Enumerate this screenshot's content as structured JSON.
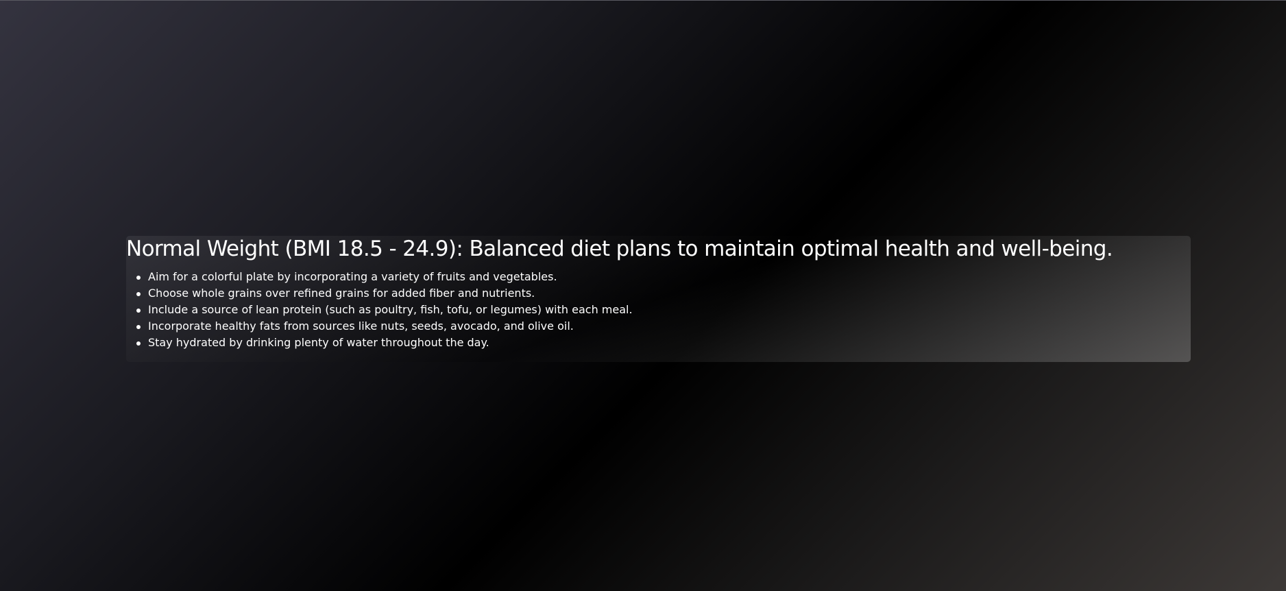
{
  "card": {
    "title": "Normal Weight (BMI 18.5 - 24.9): Balanced diet plans to maintain optimal health and well-being.",
    "tips": [
      "Aim for a colorful plate by incorporating a variety of fruits and vegetables.",
      "Choose whole grains over refined grains for added fiber and nutrients.",
      "Include a source of lean protein (such as poultry, fish, tofu, or legumes) with each meal.",
      "Incorporate healthy fats from sources like nuts, seeds, avocado, and olive oil.",
      "Stay hydrated by drinking plenty of water throughout the day."
    ]
  }
}
